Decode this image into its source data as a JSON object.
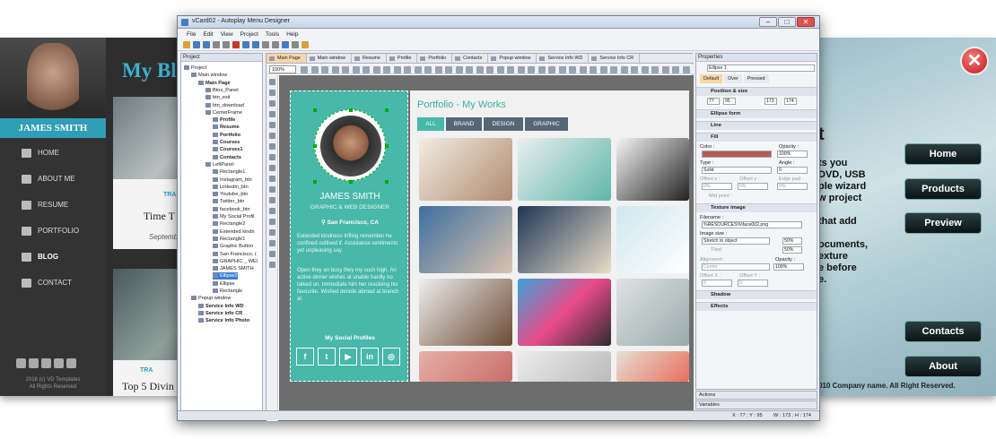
{
  "left_template": {
    "name": "JAMES SMITH",
    "blog_title": "My Bl",
    "nav": [
      "HOME",
      "ABOUT ME",
      "RESUME",
      "PORTFOLIO",
      "BLOG",
      "CONTACT"
    ],
    "post1_tag": "TRA",
    "post1_title": "Time T",
    "post1_date": "Septemb",
    "post2_tag": "TRA",
    "post2_title": "Top 5 Divin",
    "copyright": "2018 (c) VD Templates\nAll Rights Reserved"
  },
  "right_template": {
    "close_glyph": "✕",
    "buttons": [
      "Home",
      "Products",
      "Preview",
      "Contacts",
      "About"
    ],
    "partial_text": [
      "t",
      "ts you",
      "DVD, USB",
      "ple wizard",
      "w project",
      "",
      "that add",
      "",
      "ocuments,",
      "exture",
      "e before",
      "e."
    ],
    "footer": "010 Company name. All Right Reserved."
  },
  "window": {
    "title": "vCard02 - Autoplay Menu Designer",
    "menu": [
      "File",
      "Edit",
      "View",
      "Project",
      "Tools",
      "Help"
    ],
    "project_panel_title": "Project",
    "tree": [
      {
        "label": "Project",
        "depth": 0,
        "bold": false
      },
      {
        "label": "Main window",
        "depth": 1,
        "bold": false
      },
      {
        "label": "Main Page",
        "depth": 2,
        "bold": true
      },
      {
        "label": "Btns_Panel",
        "depth": 3,
        "bold": false
      },
      {
        "label": "btn_exit",
        "depth": 3,
        "bold": false
      },
      {
        "label": "btn_download",
        "depth": 3,
        "bold": false
      },
      {
        "label": "CenterFrame",
        "depth": 3,
        "bold": false
      },
      {
        "label": "Profile",
        "depth": 4,
        "bold": true
      },
      {
        "label": "Resume",
        "depth": 4,
        "bold": true
      },
      {
        "label": "Portfolio",
        "depth": 4,
        "bold": true
      },
      {
        "label": "Courses",
        "depth": 4,
        "bold": true
      },
      {
        "label": "Courses1",
        "depth": 4,
        "bold": true
      },
      {
        "label": "Contacts",
        "depth": 4,
        "bold": true
      },
      {
        "label": "LeftPanel",
        "depth": 3,
        "bold": false
      },
      {
        "label": "Rectangle1",
        "depth": 4,
        "bold": false
      },
      {
        "label": "Instagram_btn",
        "depth": 4,
        "bold": false
      },
      {
        "label": "Linkedin_btn",
        "depth": 4,
        "bold": false
      },
      {
        "label": "Youtube_btn",
        "depth": 4,
        "bold": false
      },
      {
        "label": "Twitter_btn",
        "depth": 4,
        "bold": false
      },
      {
        "label": "facebook_btn",
        "depth": 4,
        "bold": false
      },
      {
        "label": "My Social Profil",
        "depth": 4,
        "bold": false
      },
      {
        "label": "Rectangle2",
        "depth": 4,
        "bold": false
      },
      {
        "label": "Extended kindn",
        "depth": 4,
        "bold": false
      },
      {
        "label": "Rectangle1",
        "depth": 4,
        "bold": false
      },
      {
        "label": "Graphic Button",
        "depth": 4,
        "bold": false
      },
      {
        "label": "San Francisco, (",
        "depth": 4,
        "bold": false
      },
      {
        "label": "GRAPHIC _ WEI",
        "depth": 4,
        "bold": false
      },
      {
        "label": "JAMES SMITH",
        "depth": 4,
        "bold": false
      },
      {
        "label": "Ellipse2",
        "depth": 4,
        "bold": false,
        "selected": true
      },
      {
        "label": "Ellipse",
        "depth": 4,
        "bold": false
      },
      {
        "label": "Rectangle",
        "depth": 4,
        "bold": false
      },
      {
        "label": "Popup window",
        "depth": 1,
        "bold": false
      },
      {
        "label": "Service Info WD",
        "depth": 2,
        "bold": true
      },
      {
        "label": "Service Info CR",
        "depth": 2,
        "bold": true
      },
      {
        "label": "Service Info Photo",
        "depth": 2,
        "bold": true
      }
    ],
    "tabs": [
      "Main Page",
      "Main window",
      "Resume",
      "Profile",
      "Portfolio",
      "Contacts",
      "Popup window",
      "Service Info WD",
      "Service Info CR"
    ],
    "zoom": "100%",
    "card": {
      "name": "JAMES SMITH",
      "role": "GRAPHIC & WEB DESIGNER",
      "location": "San Francisco, CA",
      "para1": "Extended kindness trifling remember he confined outlived if. Assistance sentiments yet unpleasing say.",
      "para2": "Open they an busy they my such high. An active dinner wishes at unable hardly no talked on. Immediate him her resolving his favourite. Wished denote abroad at branch at.",
      "social_title": "My Social Profiles",
      "social_icons": [
        "f",
        "t",
        "▶",
        "in",
        "◎"
      ]
    },
    "portfolio": {
      "title": "Portfolio - My Works",
      "filters": [
        "ALL",
        "BRAND",
        "DESIGN",
        "GRAPHIC"
      ]
    },
    "properties": {
      "title": "Properties",
      "object": "Ellipse 1",
      "tabs": [
        "Default",
        "Over",
        "Pressed"
      ],
      "pos_size": "Position & size",
      "x": "77",
      "y": "95",
      "w": "173",
      "h": "174",
      "ellipse_form": "Ellipse form",
      "line": "Line",
      "fill": "Fill",
      "color_label": "Color :",
      "opacity_label": "Opacity :",
      "opacity": "100%",
      "type_label": "Type :",
      "type": "Solid",
      "angle_label": "Angle :",
      "angle": "0",
      "offsetx_label": "Offset x :",
      "offsety_label": "Offset y :",
      "edge_label": "Edge pad :",
      "mid_label": "Mid point :",
      "pct": "0%",
      "texture": "Texture image",
      "filename_label": "Filename :",
      "filename": "%RESOURCES%\\face002.png",
      "image_size_label": "Image size :",
      "image_size": "Stretch to object",
      "sx": "50%",
      "sy": "50%",
      "tiled": "Tiled",
      "alignment_label": "Alignment :",
      "alignment": "Center",
      "opacity2": "100%",
      "offsetx2_label": "Offset X :",
      "offsety2_label": "Offset Y :",
      "zero": "0",
      "shadow": "Shadow",
      "effects": "Effects",
      "actions": "Actions",
      "variables": "Variables"
    },
    "status": {
      "xy": "X : 77 ; Y : 95",
      "wh": "W : 173 ; H : 174"
    }
  },
  "colors": {
    "teal": "#47b8a9",
    "accent": "#3a7fd6",
    "fill_color": "#b85a5a"
  }
}
